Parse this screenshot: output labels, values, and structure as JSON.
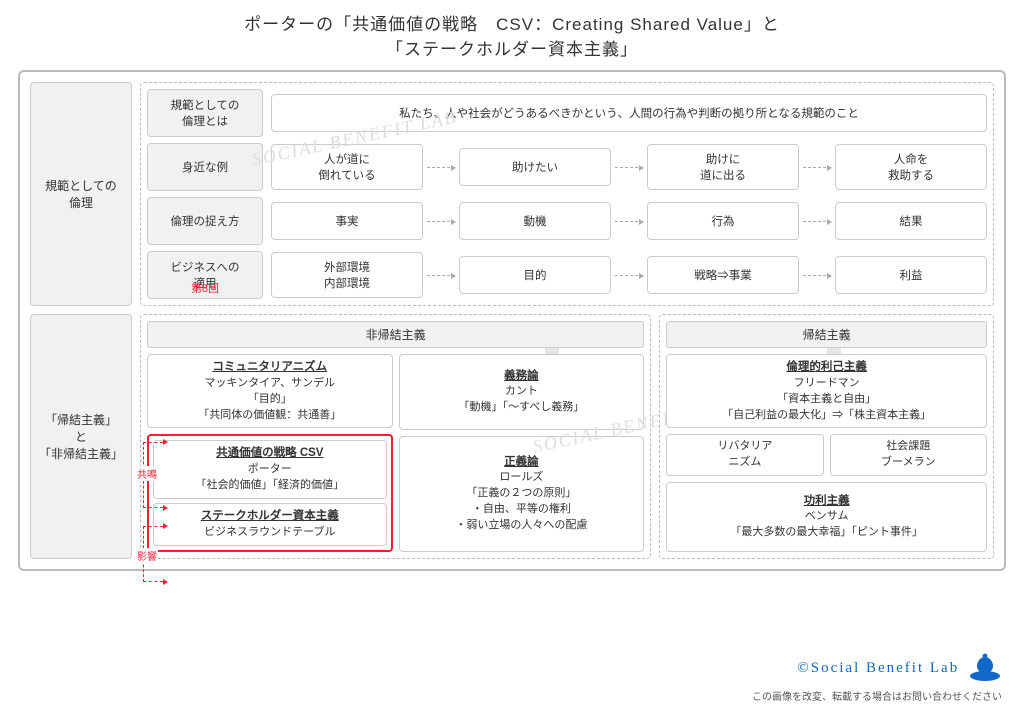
{
  "title_line1": "ポーターの「共通価値の戦略　CSV：Creating Shared Value」と",
  "title_line2": "「ステークホルダー資本主義」",
  "top_pillar": "規範としての\n倫理",
  "rows": [
    {
      "label": "規範としての\n倫理とは",
      "wide": "私たち、人や社会がどうあるべきかという、人間の行為や判断の拠り所となる規範のこと"
    },
    {
      "label": "身近な例",
      "cells": [
        "人が道に\n倒れている",
        "助けたい",
        "助けに\n道に出る",
        "人命を\n救助する"
      ]
    },
    {
      "label": "倫理の捉え方",
      "cells": [
        "事実",
        "動機",
        "行為",
        "結果"
      ]
    },
    {
      "label": "ビジネスへの\n適用",
      "annot": "第8回",
      "cells": [
        "外部環境\n内部環境",
        "目的",
        "戦略⇒事業",
        "利益"
      ]
    }
  ],
  "bottom_pillar": "「帰結主義」\nと\n「非帰結主義」",
  "col_left_header": "非帰結主義",
  "col_right_header": "帰結主義",
  "left_sub1_card1": {
    "h": "コミュニタリアニズム",
    "lines": [
      "マッキンタイア、サンデル",
      "「目的」",
      "「共同体の価値観：共通善」"
    ]
  },
  "left_sub1_card2": {
    "h": "共通価値の戦略 CSV",
    "lines": [
      "ポーター",
      "「社会的価値」「経済的価値」"
    ]
  },
  "left_sub1_card3": {
    "h": "ステークホルダー資本主義",
    "lines": [
      "ビジネスラウンドテーブル"
    ]
  },
  "left_sub2_card1": {
    "h": "義務論",
    "lines": [
      "カント",
      "「動機」「～すべし義務」"
    ]
  },
  "left_sub2_card2": {
    "h": "正義論",
    "lines": [
      "ロールズ",
      "「正義の２つの原則」",
      "・自由、平等の権利",
      "・弱い立場の人々への配慮"
    ]
  },
  "right_card1": {
    "h": "倫理的利己主義",
    "lines": [
      "フリードマン",
      "「資本主義と自由」",
      "「自己利益の最大化」⇒「株主資本主義」"
    ]
  },
  "right_pair": [
    "リバタリア\nニズム",
    "社会課題\nブーメラン"
  ],
  "right_card2": {
    "h": "功利主義",
    "lines": [
      "ベンサム",
      "「最大多数の最大幸福」「ピント事件」"
    ]
  },
  "annot_kyomei": "共鳴",
  "annot_eikyo": "影響",
  "watermark": "SOCIAL BENEFIT LAB",
  "footer_brand": "©Social Benefit Lab",
  "footer_note": "この画像を改変、転載する場合はお問い合わせください"
}
